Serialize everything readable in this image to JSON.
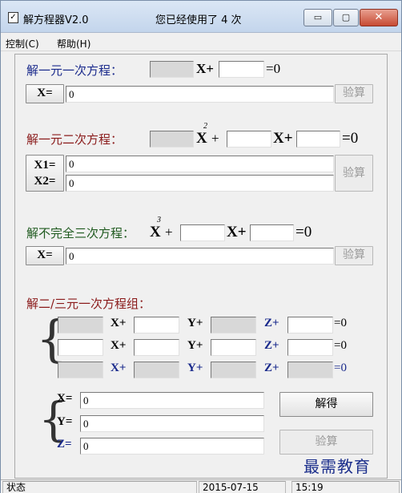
{
  "window": {
    "title": "解方程器V2.0",
    "usage_text": "您已经使用了 4 次",
    "icon": "checkbox-icon",
    "buttons": {
      "min_glyph": "▭",
      "max_glyph": "▢",
      "close_glyph": "✕"
    }
  },
  "menu": {
    "items": [
      "控制(C)",
      "帮助(H)"
    ]
  },
  "linear": {
    "title": "解一元一次方程：",
    "x_plus": "X+",
    "equals_zero": "=0",
    "result_label": "X=",
    "result_value": "0",
    "verify_label": "验算"
  },
  "quadratic": {
    "title": "解一元二次方程：",
    "x_term": "X",
    "exponent": "2",
    "plus": "+",
    "x_plus": "X+",
    "equals_zero": "=0",
    "result_labels": [
      "X1=",
      "X2="
    ],
    "result_values": [
      "0",
      "0"
    ],
    "verify_label": "验算"
  },
  "cubic": {
    "title": "解不完全三次方程：",
    "x_term": "X",
    "exponent": "3",
    "plus": "+",
    "x_plus": "X+",
    "equals_zero": "=0",
    "result_label": "X=",
    "result_value": "0",
    "verify_label": "验算"
  },
  "system": {
    "title": "解二/三元一次方程组：",
    "terms": [
      "X+",
      "Y+",
      "Z+",
      "=0"
    ],
    "results": [
      {
        "label": "X=",
        "value": "0"
      },
      {
        "label": "Y=",
        "value": "0"
      },
      {
        "label": "Z=",
        "value": "0"
      }
    ],
    "solve_label": "解得",
    "verify_label": "验算"
  },
  "status": {
    "label": "状态",
    "date": "2015-07-15",
    "time": "15:19"
  },
  "watermark": "最需教育",
  "colors": {
    "linear_title": "#1a2a8c",
    "quadratic_title": "#8a1a1a",
    "cubic_title": "#1f5a1f",
    "system_title": "#8a1a1a"
  }
}
